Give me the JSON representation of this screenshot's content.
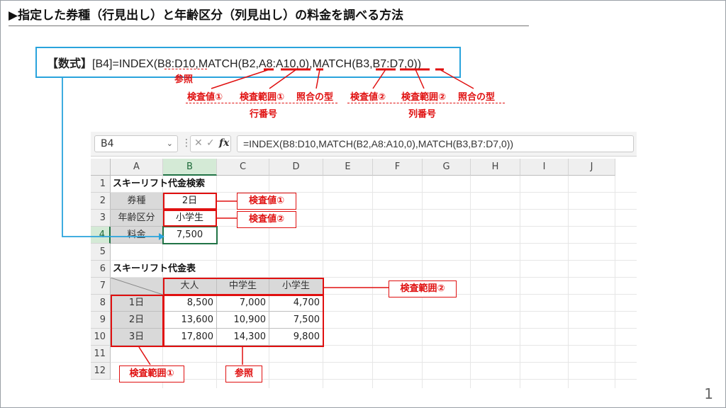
{
  "title": "▶指定した券種（行見出し）と年齢区分（列見出し）の料金を調べる方法",
  "formula_line": {
    "label": "【数式】",
    "cell_ref": "[B4]",
    "formula": "=INDEX(B8:D10,MATCH(B2,A8:A10,0),MATCH(B3,B7:D7,0))"
  },
  "annotations": {
    "ref": "参照",
    "lookup_value_1": "検査値①",
    "lookup_range_1": "検査範囲①",
    "match_type_1": "照合の型",
    "row_number": "行番号",
    "lookup_value_2": "検査値②",
    "lookup_range_2": "検査範囲②",
    "match_type_2": "照合の型",
    "col_number": "列番号"
  },
  "excel": {
    "name_box": "B4",
    "name_box_chevron": "⌄",
    "formula_bar": "=INDEX(B8:D10,MATCH(B2,A8:A10,0),MATCH(B3,B7:D7,0))",
    "columns": [
      "A",
      "B",
      "C",
      "D",
      "E",
      "F",
      "G",
      "H",
      "I",
      "J"
    ],
    "rows": [
      "1",
      "2",
      "3",
      "4",
      "5",
      "6",
      "7",
      "8",
      "9",
      "10",
      "11",
      "12"
    ],
    "a1": "スキーリフト代金検索",
    "a2": "券種",
    "b2": "2日",
    "a3": "年齢区分",
    "b3": "小学生",
    "a4": "料金",
    "b4": "7,500",
    "a6": "スキーリフト代金表",
    "header_row": [
      "大人",
      "中学生",
      "小学生"
    ],
    "table": [
      {
        "label": "1日",
        "values": [
          "8,500",
          "7,000",
          "4,700"
        ]
      },
      {
        "label": "2日",
        "values": [
          "13,600",
          "10,900",
          "7,500"
        ]
      },
      {
        "label": "3日",
        "values": [
          "17,800",
          "14,300",
          "9,800"
        ]
      }
    ]
  },
  "callouts": {
    "lookup_value_1": "検査値①",
    "lookup_value_2": "検査値②",
    "lookup_range_2": "検査範囲②",
    "lookup_range_1": "検査範囲①",
    "ref": "参照"
  },
  "page_number": "1",
  "colors": {
    "accent_red": "#e01010",
    "accent_blue": "#29a3dc",
    "excel_green": "#217346"
  }
}
